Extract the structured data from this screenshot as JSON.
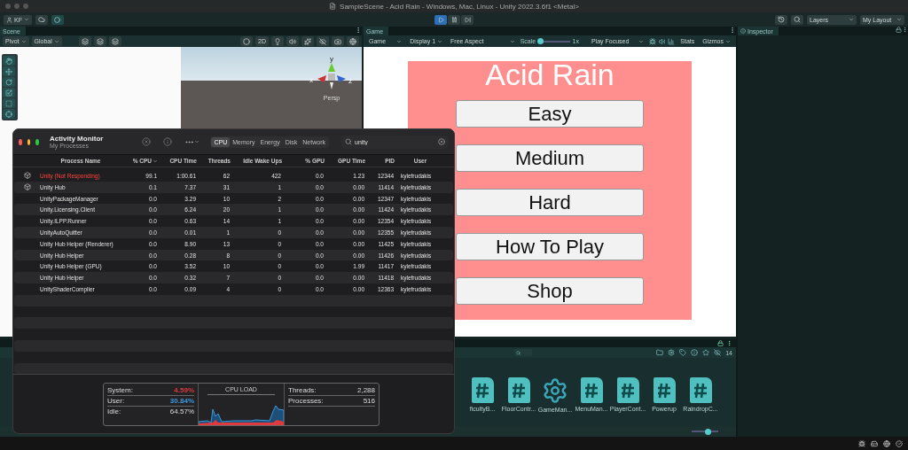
{
  "window": {
    "title": "SampleScene - Acid Rain - Windows, Mac, Linux - Unity 2022.3.6f1 <Metal>"
  },
  "toolbar": {
    "account": "KF",
    "play_controls": [
      {
        "kind": "play",
        "selected": true
      },
      {
        "kind": "pause",
        "selected": false
      },
      {
        "kind": "step",
        "selected": false
      }
    ],
    "layers": "Layers",
    "layout": "My Layout"
  },
  "scene": {
    "tab": "Scene",
    "pivot": "Pivot",
    "global": "Global",
    "mode_2d": "2D",
    "axes": [
      "y",
      "x",
      "z"
    ],
    "projection": "Persp"
  },
  "game": {
    "tab": "Game",
    "mode": "Game",
    "display": "Display 1",
    "aspect": "Free Aspect",
    "scale_label": "Scale",
    "scale": {
      "level": 0.04
    },
    "scale_value": "1x",
    "play_focused": "Play Focused",
    "stats": "Stats",
    "gizmos": "Gizmos",
    "title": "Acid Rain",
    "buttons": [
      "Easy",
      "Medium",
      "Hard",
      "How To Play",
      "Shop"
    ]
  },
  "inspector": {
    "tab": "Inspector"
  },
  "project": {
    "hidden_count": "14",
    "zoom": {
      "level": 0.6
    },
    "assets": [
      {
        "name": "ficultyB...",
        "kind": "script"
      },
      {
        "name": "FloorContr...",
        "kind": "script"
      },
      {
        "name": "GameMan...",
        "kind": "gear"
      },
      {
        "name": "MenuMan...",
        "kind": "script"
      },
      {
        "name": "PlayerCont...",
        "kind": "script"
      },
      {
        "name": "Powerup",
        "kind": "script"
      },
      {
        "name": "RaindropC...",
        "kind": "script"
      }
    ]
  },
  "activity_monitor": {
    "title": "Activity Monitor",
    "subtitle": "My Processes",
    "tabs": [
      {
        "label": "CPU",
        "selected": true
      },
      {
        "label": "Memory",
        "selected": false
      },
      {
        "label": "Energy",
        "selected": false
      },
      {
        "label": "Disk",
        "selected": false
      },
      {
        "label": "Network",
        "selected": false
      }
    ],
    "search": {
      "value": "unity"
    },
    "columns": [
      "Process Name",
      "% CPU",
      "CPU Time",
      "Threads",
      "Idle Wake Ups",
      "% GPU",
      "GPU Time",
      "PID",
      "User"
    ],
    "rows": [
      {
        "icon": true,
        "not_responding": true,
        "cells": [
          "Unity (Not Responding)",
          "99.1",
          "1:00.61",
          "62",
          "422",
          "0.0",
          "1.23",
          "12344",
          "kylefrudakis"
        ]
      },
      {
        "icon": true,
        "not_responding": false,
        "cells": [
          "Unity Hub",
          "0.1",
          "7.37",
          "31",
          "1",
          "0.0",
          "0.00",
          "11414",
          "kylefrudakis"
        ]
      },
      {
        "icon": false,
        "not_responding": false,
        "cells": [
          "UnityPackageManager",
          "0.0",
          "3.29",
          "10",
          "2",
          "0.0",
          "0.00",
          "12347",
          "kylefrudakis"
        ]
      },
      {
        "icon": false,
        "not_responding": false,
        "cells": [
          "Unity.Licensing.Client",
          "0.0",
          "6.24",
          "20",
          "1",
          "0.0",
          "0.00",
          "11424",
          "kylefrudakis"
        ]
      },
      {
        "icon": false,
        "not_responding": false,
        "cells": [
          "Unity.ILPP.Runner",
          "0.0",
          "0.63",
          "14",
          "1",
          "0.0",
          "0.00",
          "12354",
          "kylefrudakis"
        ]
      },
      {
        "icon": false,
        "not_responding": false,
        "cells": [
          "UnityAutoQuitter",
          "0.0",
          "0.01",
          "1",
          "0",
          "0.0",
          "0.00",
          "12355",
          "kylefrudakis"
        ]
      },
      {
        "icon": false,
        "not_responding": false,
        "cells": [
          "Unity Hub Helper (Renderer)",
          "0.0",
          "8.90",
          "13",
          "0",
          "0.0",
          "0.00",
          "11425",
          "kylefrudakis"
        ]
      },
      {
        "icon": false,
        "not_responding": false,
        "cells": [
          "Unity Hub Helper",
          "0.0",
          "0.28",
          "8",
          "0",
          "0.0",
          "0.00",
          "11426",
          "kylefrudakis"
        ]
      },
      {
        "icon": false,
        "not_responding": false,
        "cells": [
          "Unity Hub Helper (GPU)",
          "0.0",
          "3.52",
          "10",
          "0",
          "0.0",
          "1.99",
          "11417",
          "kylefrudakis"
        ]
      },
      {
        "icon": false,
        "not_responding": false,
        "cells": [
          "Unity Hub Helper",
          "0.0",
          "0.32",
          "7",
          "0",
          "0.0",
          "0.00",
          "11418",
          "kylefrudakis"
        ]
      },
      {
        "icon": false,
        "not_responding": false,
        "cells": [
          "UnityShaderCompiler",
          "0.0",
          "0.09",
          "4",
          "0",
          "0.0",
          "0.00",
          "12363",
          "kylefrudakis"
        ]
      }
    ],
    "stats": [
      {
        "label": "System:",
        "value": "4.59%",
        "color": "#e0393e"
      },
      {
        "label": "User:",
        "value": "30.84%",
        "color": "#3d9be0"
      },
      {
        "label": "Idle:",
        "value": "64.57%"
      }
    ],
    "chart_title": "CPU LOAD",
    "totals": [
      {
        "label": "Threads:",
        "value": "2,288"
      },
      {
        "label": "Processes:",
        "value": "516"
      }
    ]
  }
}
